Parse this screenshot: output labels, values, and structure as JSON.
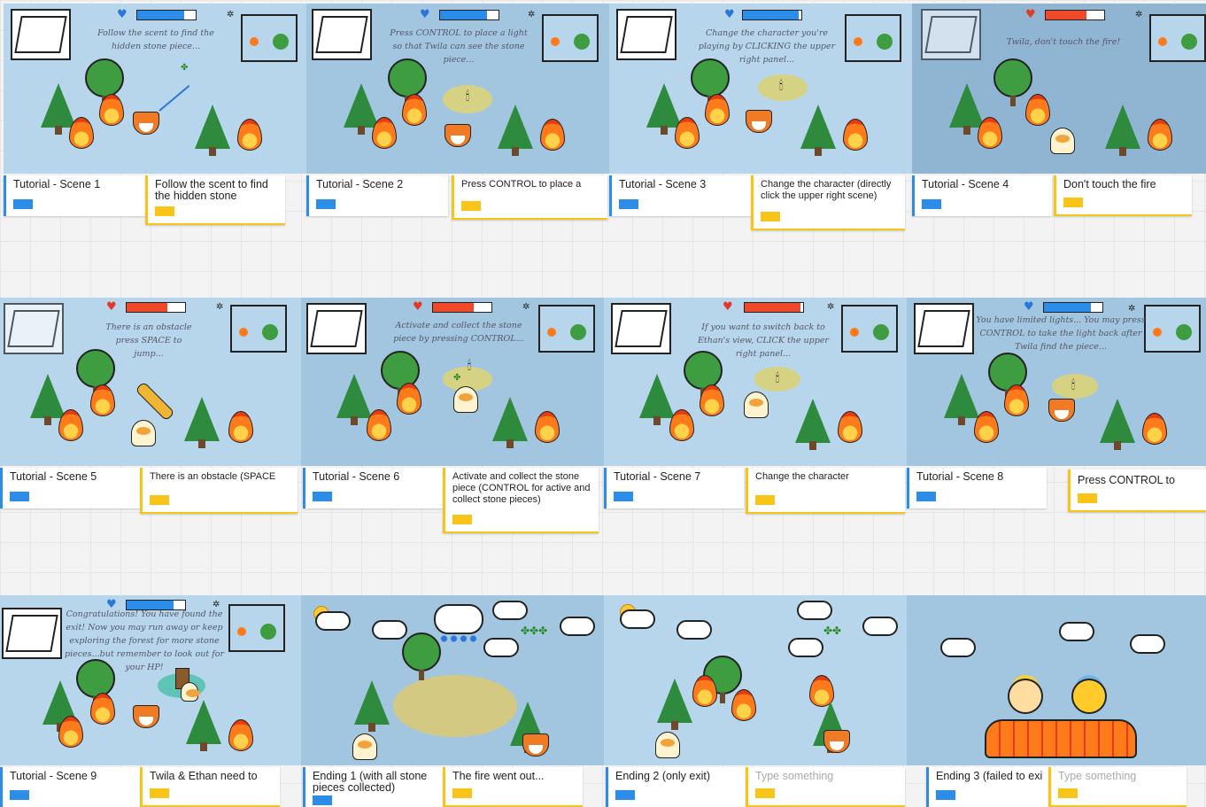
{
  "colors": {
    "blue_tag": "#2b8de8",
    "yellow_tag": "#f7c417",
    "hp_blue": "#2b8de8",
    "hp_red": "#ee4a2a"
  },
  "scenes": [
    {
      "title": "Tutorial - Scene 1",
      "note": "Follow the scent to find the hidden stone",
      "caption": "Follow the scent to find the hidden stone piece...",
      "hp_color": "blue",
      "hp_fill": 0.8
    },
    {
      "title": "Tutorial - Scene 2",
      "note": "Press CONTROL to place a",
      "caption": "Press CONTROL to place a light so that Twila can see the stone piece...",
      "hp_color": "blue",
      "hp_fill": 0.8
    },
    {
      "title": "Tutorial - Scene 3",
      "note": "Change the character (directly click the upper right scene)",
      "caption": "Change the character you're playing by CLICKING the upper right panel...",
      "hp_color": "blue",
      "hp_fill": 0.95
    },
    {
      "title": "Tutorial - Scene 4",
      "note": "Don't touch the fire",
      "caption": "Twila, don't touch the fire!",
      "hp_color": "red",
      "hp_fill": 0.7
    },
    {
      "title": "Tutorial - Scene 5",
      "note": "There is an obstacle (SPACE",
      "caption": "There is an obstacle press SPACE to jump...",
      "hp_color": "red",
      "hp_fill": 0.7
    },
    {
      "title": "Tutorial - Scene 6",
      "note": "Activate and collect the stone piece (CONTROL for active and collect stone pieces)",
      "caption": "Activate and collect the stone piece by pressing CONTROL...",
      "hp_color": "red",
      "hp_fill": 0.7
    },
    {
      "title": "Tutorial - Scene 7",
      "note": "Change the character",
      "caption": "If you want to switch back to Ethan's view, CLICK the upper right panel...",
      "hp_color": "red",
      "hp_fill": 0.95
    },
    {
      "title": "Tutorial - Scene 8",
      "note": "Press CONTROL to",
      "caption": "You have limited lights... You may press CONTROL to take the light back after Twila find the piece...",
      "hp_color": "blue",
      "hp_fill": 0.8
    },
    {
      "title": "Tutorial - Scene 9",
      "note": "Twila & Ethan need to",
      "caption": "Congratulations! You have found the exit! Now you may run away or keep exploring the forest for more stone pieces...but remember to look out for your HP!",
      "hp_color": "blue",
      "hp_fill": 0.8
    },
    {
      "title": "Ending 1 (with all stone pieces collected)",
      "note": "The fire went out...",
      "caption": ""
    },
    {
      "title": "Ending 2 (only exit)",
      "note": "Type something",
      "caption": ""
    },
    {
      "title": "Ending 3 (failed to exi",
      "note": "Type something",
      "caption": ""
    }
  ]
}
